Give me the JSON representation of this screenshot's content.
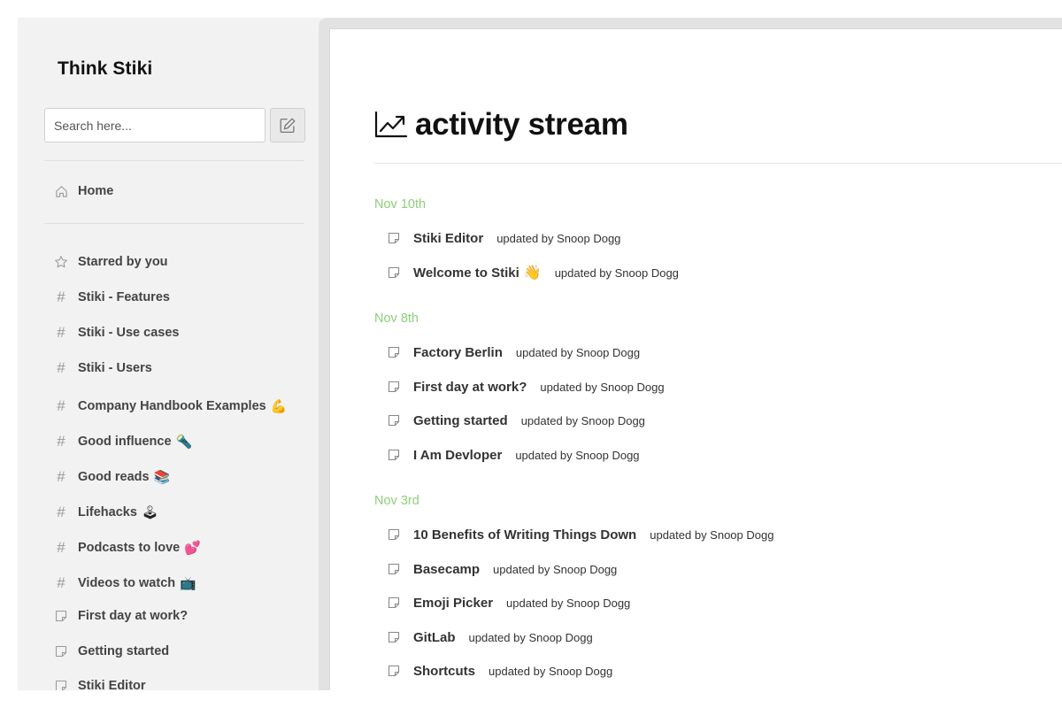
{
  "sidebar": {
    "workspace_title": "Think Stiki",
    "search": {
      "placeholder": "Search here..."
    },
    "home": {
      "label": "Home",
      "icon": "home-icon"
    },
    "items": [
      {
        "label": "Starred by you",
        "icon": "star-icon",
        "emoji": ""
      },
      {
        "label": "Stiki - Features",
        "icon": "hash-icon",
        "emoji": ""
      },
      {
        "label": "Stiki - Use cases",
        "icon": "hash-icon",
        "emoji": ""
      },
      {
        "label": "Stiki - Users",
        "icon": "hash-icon",
        "emoji": ""
      },
      {
        "label": "Company Handbook Examples",
        "icon": "hash-icon",
        "emoji": "💪"
      },
      {
        "label": "Good influence",
        "icon": "hash-icon",
        "emoji": "🔦"
      },
      {
        "label": "Good reads",
        "icon": "hash-icon",
        "emoji": "📚"
      },
      {
        "label": "Lifehacks",
        "icon": "hash-icon",
        "emoji": "🕹"
      },
      {
        "label": "Podcasts to love",
        "icon": "hash-icon",
        "emoji": "💕"
      },
      {
        "label": "Videos to watch",
        "icon": "hash-icon",
        "emoji": "📺"
      },
      {
        "label": "First day at work?",
        "icon": "document-icon",
        "emoji": ""
      },
      {
        "label": "Getting started",
        "icon": "document-icon",
        "emoji": ""
      },
      {
        "label": "Stiki Editor",
        "icon": "document-icon",
        "emoji": ""
      }
    ]
  },
  "main": {
    "title": "activity stream",
    "title_icon": "chart-line-icon",
    "accent_color": "#8ccf7a",
    "groups": [
      {
        "date": "Nov 10th",
        "items": [
          {
            "title": "Stiki Editor",
            "emoji": "",
            "meta": "updated by Snoop Dogg"
          },
          {
            "title": "Welcome to Stiki",
            "emoji": "👋",
            "meta": "updated by Snoop Dogg"
          }
        ]
      },
      {
        "date": "Nov 8th",
        "items": [
          {
            "title": "Factory Berlin",
            "emoji": "",
            "meta": "updated by Snoop Dogg"
          },
          {
            "title": "First day at work?",
            "emoji": "",
            "meta": "updated by Snoop Dogg"
          },
          {
            "title": "Getting started",
            "emoji": "",
            "meta": "updated by Snoop Dogg"
          },
          {
            "title": "I Am Devloper",
            "emoji": "",
            "meta": "updated by Snoop Dogg"
          }
        ]
      },
      {
        "date": "Nov 3rd",
        "items": [
          {
            "title": "10 Benefits of Writing Things Down",
            "emoji": "",
            "meta": "updated by Snoop Dogg"
          },
          {
            "title": "Basecamp",
            "emoji": "",
            "meta": "updated by Snoop Dogg"
          },
          {
            "title": "Emoji Picker",
            "emoji": "",
            "meta": "updated by Snoop Dogg"
          },
          {
            "title": "GitLab",
            "emoji": "",
            "meta": "updated by Snoop Dogg"
          },
          {
            "title": "Shortcuts",
            "emoji": "",
            "meta": "updated by Snoop Dogg"
          }
        ]
      }
    ]
  }
}
